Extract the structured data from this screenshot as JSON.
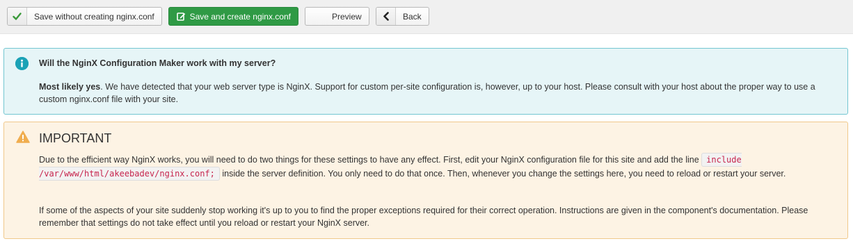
{
  "toolbar": {
    "save_without_label": "Save without creating nginx.conf",
    "save_create_label": "Save and create nginx.conf",
    "preview_label": "Preview",
    "back_label": "Back"
  },
  "info_alert": {
    "title": "Will the NginX Configuration Maker work with my server?",
    "lead_bold": "Most likely yes",
    "body": ". We have detected that your web server type is NginX. Support for custom per-site configuration is, however, up to your host. Please consult with your host about the proper way to use a custom nginx.conf file with your site."
  },
  "warning_alert": {
    "title": "IMPORTANT",
    "p1_before": "Due to the efficient way NginX works, you will need to do two things for these settings to have any effect. First, edit your NginX configuration file for this site and add the line ",
    "p1_code": "include /var/www/html/akeebadev/nginx.conf;",
    "p1_after": " inside the server definition. You only need to do that once. Then, whenever you change the settings here, you need to reload or restart your server.",
    "p2": "If some of the aspects of your site suddenly stop working it's up to you to find the proper exceptions required for their correct operation. Instructions are given in the component's documentation. Please remember that settings do not take effect until you reload or restart your NginX server."
  },
  "colors": {
    "primary_green": "#2f9a45",
    "info_accent": "#1ba2b6",
    "warning_accent": "#f0ad4e",
    "code_text": "#c7254e"
  },
  "icons": {
    "save_without": "check-icon",
    "save_create": "edit-icon",
    "back": "chevron-left-icon",
    "info": "info-icon",
    "warning": "warning-icon"
  }
}
